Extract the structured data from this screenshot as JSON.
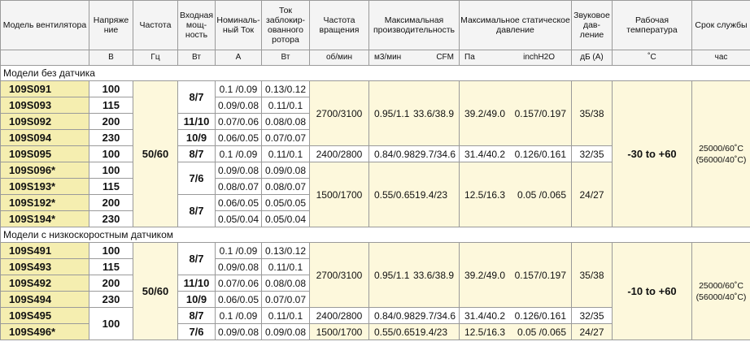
{
  "headers": {
    "model": "Модель вентилятора",
    "voltage": "Напряже ние",
    "frequency": "Частота",
    "input_power": "Входная мощ-ность",
    "rated_current": "Номиналь-ный Ток",
    "locked_rotor_current": "Ток заблокир-ованного ротора",
    "rotation_speed": "Частота вращения",
    "max_airflow": "Максимальная производительность",
    "max_static_pressure": "Максимальное статическое давление",
    "noise": "Звуковое дав-ление",
    "operating_temp": "Рабочая температура",
    "life": "Срок службы"
  },
  "units": {
    "voltage": "В",
    "frequency": "Гц",
    "input_power": "Вт",
    "rated_current": "А",
    "locked_rotor_current": "Вт",
    "rotation_speed": "об/мин",
    "airflow_m3": "м3/мин",
    "airflow_cfm": "CFM",
    "pressure_pa": "Па",
    "pressure_inch": "inchH2O",
    "noise": "дБ (А)",
    "temp": "˚С",
    "life": "час"
  },
  "sections": [
    {
      "title": "Модели без датчика",
      "frequency": "50/60",
      "temp": "-30 to +60",
      "life_1": "25000/60˚C",
      "life_2": "(56000/40˚C)",
      "models": [
        "109S091",
        "109S093",
        "109S092",
        "109S094",
        "109S095",
        "109S096*",
        "109S193*",
        "109S192*",
        "109S194*"
      ],
      "voltages": [
        "100",
        "115",
        "200",
        "230",
        "100",
        "100",
        "115",
        "200",
        "230"
      ],
      "power": [
        "8/7",
        "11/10",
        "10/9",
        "8/7",
        "7/6",
        "8/7"
      ],
      "current": [
        "0.1 /0.09",
        "0.09/0.08",
        "0.07/0.06",
        "0.06/0.05",
        "0.1 /0.09",
        "0.09/0.08",
        "0.08/0.07",
        "0.06/0.05",
        "0.05/0.04"
      ],
      "locked": [
        "0.13/0.12",
        "0.11/0.1",
        "0.08/0.08",
        "0.07/0.07",
        "0.11/0.1",
        "0.09/0.08",
        "0.08/0.07",
        "0.05/0.05",
        "0.05/0.04"
      ],
      "groups": [
        {
          "speed": "2700/3100",
          "m3": "0.95/1.1",
          "cfm": "33.6/38.9",
          "pa": "39.2/49.0",
          "inch": "0.157/0.197",
          "noise": "35/38"
        },
        {
          "speed": "2400/2800",
          "m3": "0.84/0.98",
          "cfm": "29.7/34.6",
          "pa": "31.4/40.2",
          "inch": "0.126/0.161",
          "noise": "32/35"
        },
        {
          "speed": "1500/1700",
          "m3": "0.55/0.65",
          "cfm": "19.4/23",
          "pa": "12.5/16.3",
          "inch": "0.05 /0.065",
          "noise": "24/27"
        }
      ]
    },
    {
      "title": "Модели с низкоскоростным датчиком",
      "frequency": "50/60",
      "temp": "-10 to +60",
      "life_1": "25000/60˚C",
      "life_2": "(56000/40˚C)",
      "models": [
        "109S491",
        "109S493",
        "109S492",
        "109S494",
        "109S495",
        "109S496*"
      ],
      "voltages": [
        "100",
        "115",
        "200",
        "230",
        "100"
      ],
      "power": [
        "8/7",
        "11/10",
        "10/9",
        "8/7",
        "7/6"
      ],
      "current": [
        "0.1 /0.09",
        "0.09/0.08",
        "0.07/0.06",
        "0.06/0.05",
        "0.1 /0.09",
        "0.09/0.08"
      ],
      "locked": [
        "0.13/0.12",
        "0.11/0.1",
        "0.08/0.08",
        "0.07/0.07",
        "0.11/0.1",
        "0.09/0.08"
      ],
      "groups": [
        {
          "speed": "2700/3100",
          "m3": "0.95/1.1",
          "cfm": "33.6/38.9",
          "pa": "39.2/49.0",
          "inch": "0.157/0.197",
          "noise": "35/38"
        },
        {
          "speed": "2400/2800",
          "m3": "0.84/0.98",
          "cfm": "29.7/34.6",
          "pa": "31.4/40.2",
          "inch": "0.126/0.161",
          "noise": "32/35"
        },
        {
          "speed": "1500/1700",
          "m3": "0.55/0.65",
          "cfm": "19.4/23",
          "pa": "12.5/16.3",
          "inch": "0.05 /0.065",
          "noise": "24/27"
        }
      ]
    }
  ]
}
